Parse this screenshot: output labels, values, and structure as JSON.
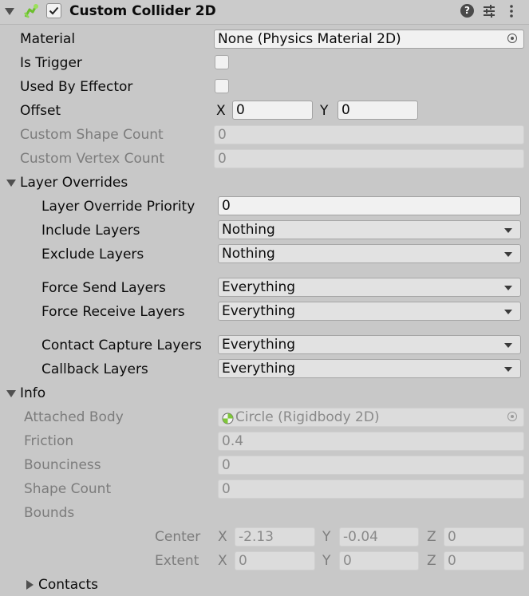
{
  "header": {
    "title": "Custom Collider 2D",
    "enabled": true,
    "icons": [
      "fold-arrow",
      "collider-icon",
      "help-icon",
      "presets-icon",
      "kebab-menu-icon"
    ]
  },
  "props": {
    "material": {
      "label": "Material",
      "value": "None (Physics Material 2D)"
    },
    "is_trigger": {
      "label": "Is Trigger"
    },
    "used_by_effector": {
      "label": "Used By Effector"
    },
    "offset": {
      "label": "Offset",
      "x_label": "X",
      "x": "0",
      "y_label": "Y",
      "y": "0"
    },
    "custom_shape_count": {
      "label": "Custom Shape Count",
      "value": "0"
    },
    "custom_vertex_count": {
      "label": "Custom Vertex Count",
      "value": "0"
    }
  },
  "layer_overrides": {
    "label": "Layer Overrides",
    "priority": {
      "label": "Layer Override Priority",
      "value": "0"
    },
    "include": {
      "label": "Include Layers",
      "value": "Nothing"
    },
    "exclude": {
      "label": "Exclude Layers",
      "value": "Nothing"
    },
    "force_send": {
      "label": "Force Send Layers",
      "value": "Everything"
    },
    "force_receive": {
      "label": "Force Receive Layers",
      "value": "Everything"
    },
    "contact_capture": {
      "label": "Contact Capture Layers",
      "value": "Everything"
    },
    "callback": {
      "label": "Callback Layers",
      "value": "Everything"
    }
  },
  "info": {
    "label": "Info",
    "attached_body": {
      "label": "Attached Body",
      "value": "Circle (Rigidbody 2D)"
    },
    "friction": {
      "label": "Friction",
      "value": "0.4"
    },
    "bounciness": {
      "label": "Bounciness",
      "value": "0"
    },
    "shape_count": {
      "label": "Shape Count",
      "value": "0"
    },
    "bounds": {
      "label": "Bounds",
      "center": {
        "label": "Center",
        "x_label": "X",
        "x": "-2.13",
        "y_label": "Y",
        "y": "-0.04",
        "z_label": "Z",
        "z": "0"
      },
      "extent": {
        "label": "Extent",
        "x_label": "X",
        "x": "0",
        "y_label": "Y",
        "y": "0",
        "z_label": "Z",
        "z": "0"
      }
    },
    "contacts": {
      "label": "Contacts"
    }
  },
  "colors": {
    "panel_bg": "#c8c8c8",
    "field_bg": "#f1f1f1",
    "readonly_field_bg": "#dcdcdc",
    "accent_green": "#7ec63a"
  }
}
